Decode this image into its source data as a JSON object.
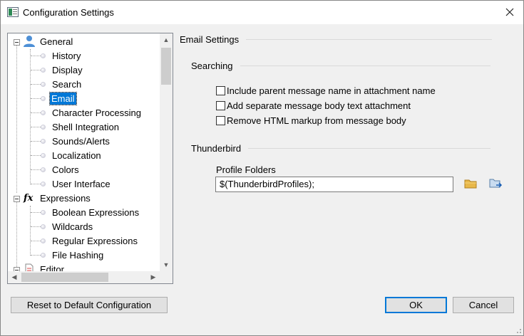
{
  "window": {
    "title": "Configuration Settings"
  },
  "tree": {
    "items": [
      {
        "label": "General",
        "icon": "user-icon",
        "level": 0
      },
      {
        "label": "History",
        "level": 1
      },
      {
        "label": "Display",
        "level": 1
      },
      {
        "label": "Search",
        "level": 1
      },
      {
        "label": "Email",
        "level": 1,
        "selected": true
      },
      {
        "label": "Character Processing",
        "level": 1
      },
      {
        "label": "Shell Integration",
        "level": 1
      },
      {
        "label": "Sounds/Alerts",
        "level": 1
      },
      {
        "label": "Localization",
        "level": 1
      },
      {
        "label": "Colors",
        "level": 1
      },
      {
        "label": "User Interface",
        "level": 1
      },
      {
        "label": "Expressions",
        "icon": "fx-icon",
        "level": 0
      },
      {
        "label": "Boolean Expressions",
        "level": 1
      },
      {
        "label": "Wildcards",
        "level": 1
      },
      {
        "label": "Regular Expressions",
        "level": 1
      },
      {
        "label": "File Hashing",
        "level": 1
      },
      {
        "label": "Editor",
        "icon": "document-icon",
        "level": 0
      }
    ]
  },
  "main": {
    "heading": "Email Settings",
    "searching": {
      "title": "Searching",
      "options": [
        {
          "label": "Include parent message name in attachment name",
          "checked": false
        },
        {
          "label": "Add separate message body text attachment",
          "checked": false
        },
        {
          "label": "Remove HTML markup from message body",
          "checked": false
        }
      ]
    },
    "thunderbird": {
      "title": "Thunderbird",
      "profile_folders_label": "Profile Folders",
      "profile_folders_value": "$(ThunderbirdProfiles);"
    }
  },
  "footer": {
    "reset_label": "Reset to Default Configuration",
    "ok_label": "OK",
    "cancel_label": "Cancel"
  },
  "colors": {
    "selection": "#0078d7",
    "folder": "#e8b84a"
  }
}
